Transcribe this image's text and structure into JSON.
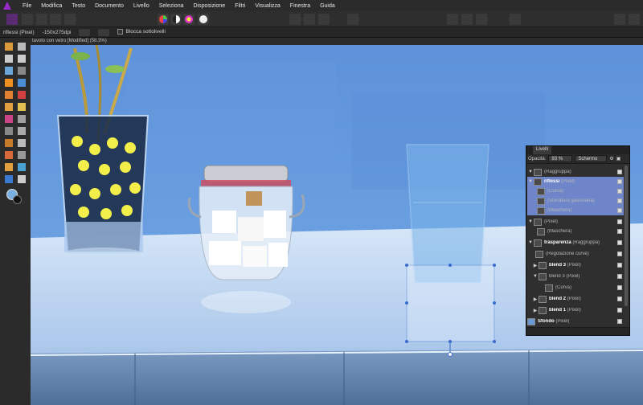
{
  "menubar": {
    "items": [
      "File",
      "Modifica",
      "Testo",
      "Documento",
      "Livello",
      "Seleziona",
      "Disposizione",
      "Filtri",
      "Visualizza",
      "Finestra",
      "Guida"
    ]
  },
  "contextbar": {
    "layer_info": "riflessi (Pixel)",
    "dpi": "-150x275dpi",
    "lock_children": "Blocca sottolivelli"
  },
  "document": {
    "tab_title": "tavolo con vetro [Modified] (58.3%)"
  },
  "layers_panel": {
    "tab_label": "Livelli",
    "opacity_label": "Opacità:",
    "opacity_value": "93 %",
    "blend_mode": "Schermo",
    "rows": [
      {
        "name": "",
        "type": "(Raggruppa)"
      },
      {
        "name": "riflessi",
        "type": "(Pixel)"
      },
      {
        "name": "",
        "type": "(Curva)"
      },
      {
        "name": "",
        "type": "(Sfocatura gaussiana)"
      },
      {
        "name": "",
        "type": "(Maschera)"
      },
      {
        "name": "",
        "type": "(Pixel)"
      },
      {
        "name": "",
        "type": "(Maschera)"
      },
      {
        "name": "trasparenza",
        "type": "(Raggruppa)"
      },
      {
        "name": "",
        "type": "(Regolazione curve)"
      },
      {
        "name": "blend 3",
        "type": "(Pixel)"
      },
      {
        "name": "blend 3",
        "type": "(Pixel)"
      },
      {
        "name": "",
        "type": "(Curva)"
      },
      {
        "name": "blend 2",
        "type": "(Pixel)"
      },
      {
        "name": "blend 1",
        "type": "(Pixel)"
      },
      {
        "name": "Sfondo",
        "type": "(Pixel)"
      }
    ]
  },
  "colors": {
    "accent": "#9b2bc9",
    "selection": "#6e86c9",
    "wall": "#5c8fd6",
    "table": "#c9dcf2"
  }
}
